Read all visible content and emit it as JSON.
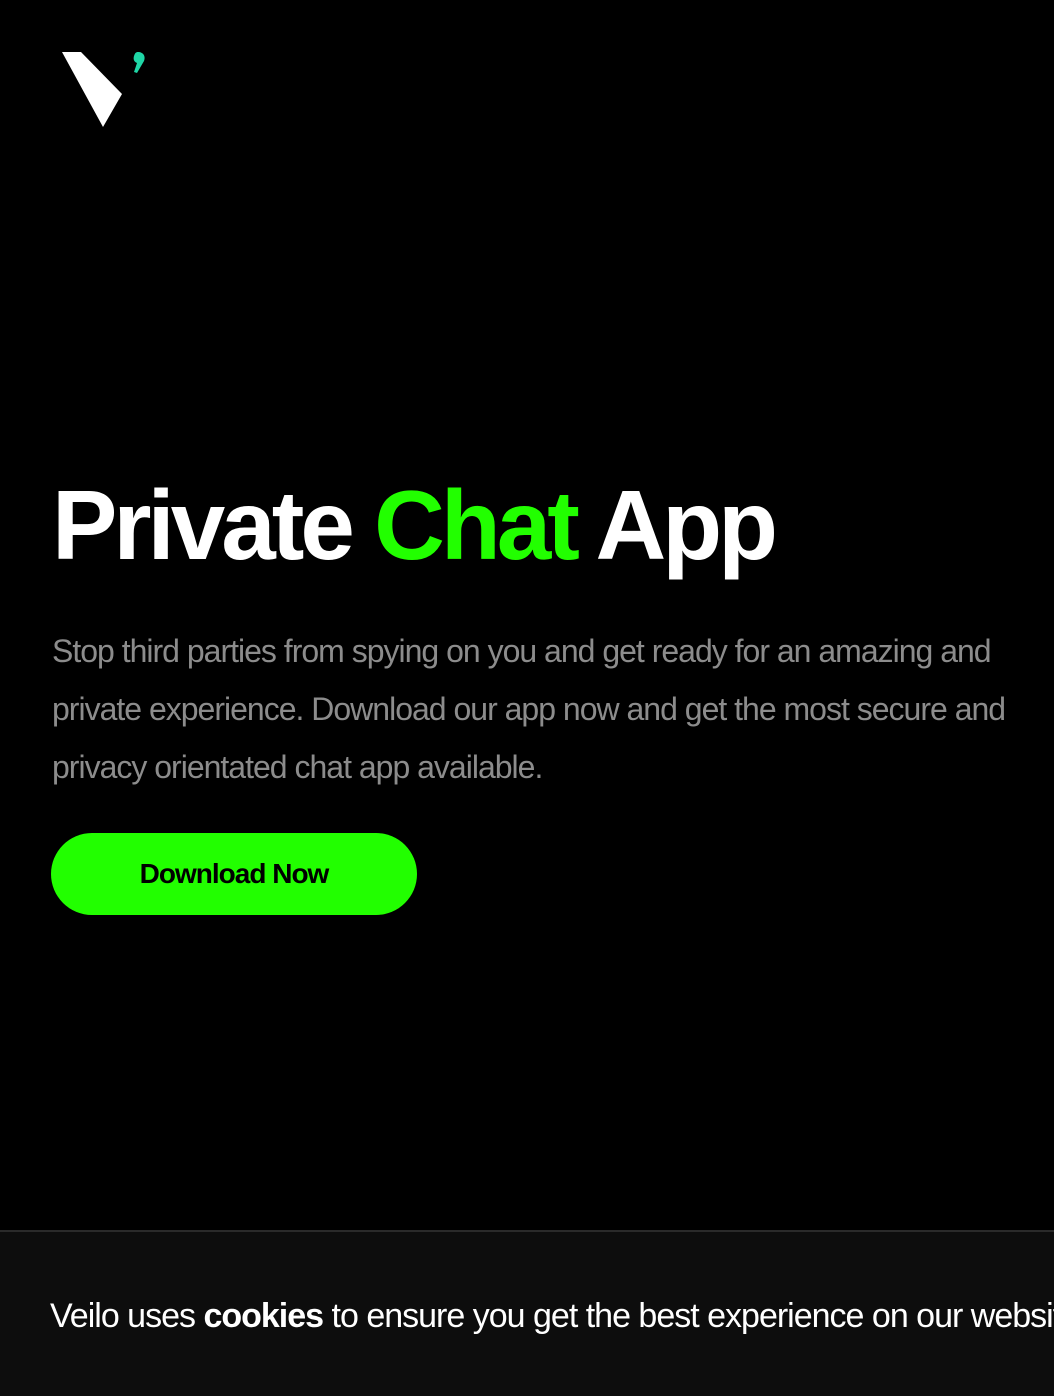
{
  "brand": {
    "logo_icon": "veilo-v-logo-icon",
    "logo_color": "#ffffff",
    "logo_accent_color": "#1fd6a6"
  },
  "hero": {
    "title_part1": "Private",
    "title_highlight": "Chat",
    "title_part2": "App",
    "highlight_color": "#22ff00",
    "description": "Stop third parties from spying on you and get ready for an amazing and private experience. Download our app now and get the most secure and privacy orientated chat app available.",
    "cta_label": "Download Now",
    "cta_color": "#22ff00"
  },
  "cookie_banner": {
    "text_before": "Veilo uses",
    "text_bold": "cookies",
    "text_after": "to ensure you get the best experience on our website."
  }
}
